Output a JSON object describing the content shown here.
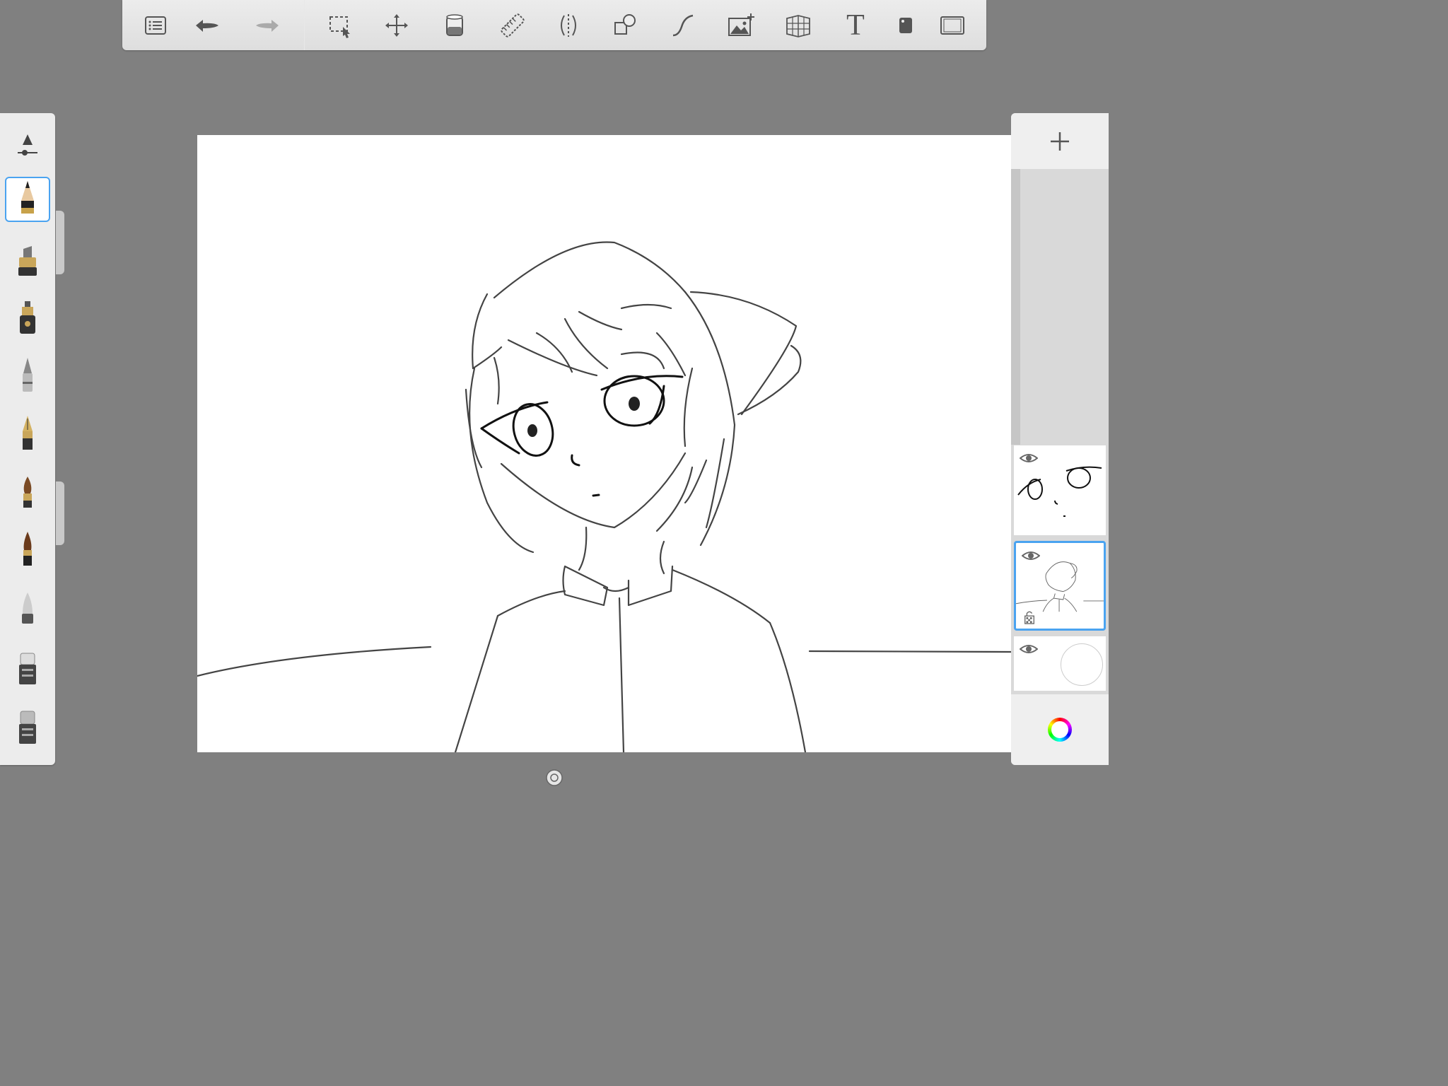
{
  "toolbar": {
    "items": [
      {
        "name": "menu",
        "icon": "list-icon"
      },
      {
        "name": "undo",
        "icon": "undo-icon"
      },
      {
        "name": "redo",
        "icon": "redo-icon",
        "disabled": true
      },
      {
        "name": "selection",
        "icon": "selection-icon"
      },
      {
        "name": "transform",
        "icon": "move-icon"
      },
      {
        "name": "fill",
        "icon": "paint-bucket-icon"
      },
      {
        "name": "ruler",
        "icon": "ruler-icon"
      },
      {
        "name": "symmetry",
        "icon": "symmetry-icon"
      },
      {
        "name": "shapes",
        "icon": "shapes-icon"
      },
      {
        "name": "curve",
        "icon": "stroke-curve-icon"
      },
      {
        "name": "import-image",
        "icon": "add-image-icon"
      },
      {
        "name": "perspective",
        "icon": "perspective-grid-icon"
      },
      {
        "name": "text",
        "icon": "text-icon",
        "label": "T"
      },
      {
        "name": "fullscreen",
        "icon": "phone-icon"
      },
      {
        "name": "canvas-frame",
        "icon": "frame-icon"
      }
    ]
  },
  "brushes": {
    "header_icon": "brush-properties-icon",
    "items": [
      {
        "name": "pencil",
        "icon": "pencil-icon",
        "selected": true
      },
      {
        "name": "marker",
        "icon": "marker-icon"
      },
      {
        "name": "airbrush",
        "icon": "airbrush-icon"
      },
      {
        "name": "ballpoint",
        "icon": "ballpoint-pen-icon"
      },
      {
        "name": "fountain-pen",
        "icon": "fountain-pen-icon"
      },
      {
        "name": "paintbrush",
        "icon": "paintbrush-icon"
      },
      {
        "name": "ink-brush",
        "icon": "ink-brush-icon"
      },
      {
        "name": "soft-eraser",
        "icon": "soft-eraser-icon"
      },
      {
        "name": "eraser",
        "icon": "eraser-icon"
      },
      {
        "name": "hard-eraser",
        "icon": "hard-eraser-icon"
      }
    ]
  },
  "layers": {
    "add_icon": "plus-icon",
    "items": [
      {
        "name": "eyes-layer",
        "visible": true,
        "selected": false,
        "locked": false
      },
      {
        "name": "sketch-layer",
        "visible": true,
        "selected": true,
        "locked": true
      },
      {
        "name": "background-layer",
        "visible": true,
        "selected": false,
        "locked": false
      }
    ]
  },
  "color_picker": {
    "icon": "color-wheel-icon"
  },
  "colors": {
    "accent": "#4aa3f0",
    "canvas_bg": "#808080",
    "panel": "#ececec"
  }
}
